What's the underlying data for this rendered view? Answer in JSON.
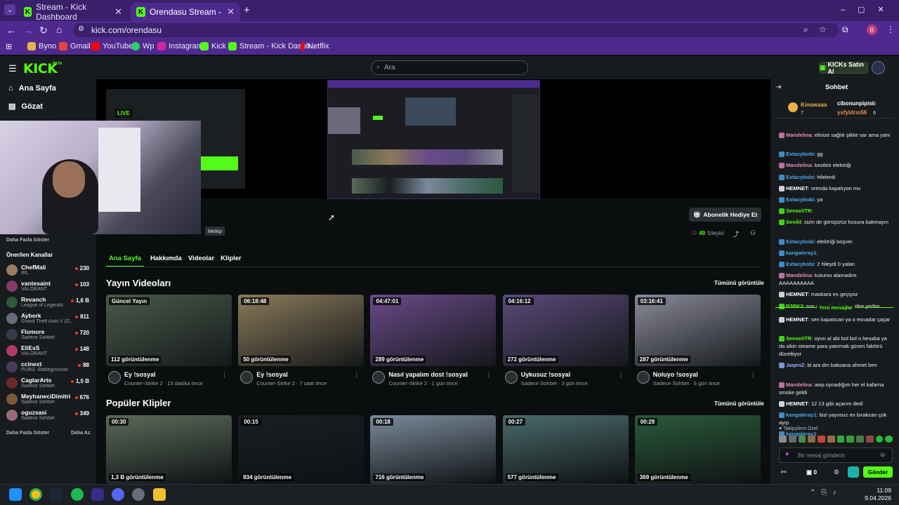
{
  "browser": {
    "tabs": [
      {
        "label": "Stream - Kick Dashboard"
      },
      {
        "label": "Orendasu Stream - Watch Live -"
      }
    ],
    "url": "kick.com/orendasu",
    "bookmarks": [
      "Byno",
      "Gmail",
      "YouTube",
      "Wp",
      "Instagram",
      "Kick",
      "Stream - Kick Dashb...",
      "Netflix"
    ],
    "profile_initial": "B"
  },
  "header": {
    "logo": "KICK",
    "logo_badge": "BETA",
    "search_placeholder": "Ara",
    "buy_label": "KICKs Satın Al"
  },
  "sidebar": {
    "nav": [
      {
        "label": "Ana Sayfa"
      },
      {
        "label": "Gözat"
      }
    ],
    "show_more": "Daha Fazla Göster",
    "recommended_title": "Önerilen Kanallar",
    "channels": [
      {
        "name": "ChefMali",
        "category": "IRL",
        "viewers": "230",
        "color": "#9a7b62"
      },
      {
        "name": "vantesaint",
        "category": "VALORANT",
        "viewers": "103",
        "color": "#8a3a6a"
      },
      {
        "name": "Revanch",
        "category": "League of Legends",
        "viewers": "1,6 B",
        "color": "#2a5a3a"
      },
      {
        "name": "Ayberk",
        "category": "Grand Theft Auto V (G...",
        "viewers": "811",
        "color": "#6a6a7a"
      },
      {
        "name": "Flomore",
        "category": "Sadece Sohbet",
        "viewers": "720",
        "color": "#3a3a4a"
      },
      {
        "name": "EliEsS",
        "category": "VALORANT",
        "viewers": "148",
        "color": "#b03a6a"
      },
      {
        "name": "ccinext",
        "category": "PUBG: Battlegrounds",
        "viewers": "88",
        "color": "#4a3a5a"
      },
      {
        "name": "CaglarArts",
        "category": "Sadece Sohbet",
        "viewers": "1,5 B",
        "color": "#6a2a2a"
      },
      {
        "name": "MeyhaneciDimitri",
        "category": "Sadece Sohbet",
        "viewers": "676",
        "color": "#7a5a3a"
      },
      {
        "name": "oguzsasi",
        "category": "Sadece Sohbet",
        "viewers": "349",
        "color": "#9a6a7a"
      }
    ],
    "show_more_bottom": "Daha Fazla Göster",
    "show_less": "Daha Az"
  },
  "player": {
    "live_label": "LIVE",
    "clip_label": "Mekip"
  },
  "stream_bar": {
    "sub_gift_label": "Abonelik Hediye Et",
    "viewers": "49",
    "viewers_label": "İzleyici"
  },
  "content_tabs": [
    "Ana Sayfa",
    "Hakkımda",
    "Videolar",
    "Klipler"
  ],
  "videos_section": {
    "title": "Yayın Videoları",
    "see_all": "Tümünü görüntüle",
    "items": [
      {
        "badge": "Güncel Yayın",
        "views": "112 görüntülenme",
        "title": "Ey !sosyal",
        "sub": "Counter-Strike 2 · 15 dakika önce",
        "bg": "#4a5a4a"
      },
      {
        "badge": "06:18:48",
        "views": "50 görüntülenme",
        "title": "Ey !sosyal",
        "sub": "Counter-Strike 2 · 7 saat önce",
        "bg": "#8a7a5a"
      },
      {
        "badge": "04:47:01",
        "views": "289 görüntülenme",
        "title": "Nasıl yapalım dost !sosyal",
        "sub": "Counter-Strike 2 · 1 gün önce",
        "bg": "#6a4a8a"
      },
      {
        "badge": "04:16:12",
        "views": "272 görüntülenme",
        "title": "Uykusuz !sosyal",
        "sub": "Sadece Sohbet · 3 gün önce",
        "bg": "#5a4a7a"
      },
      {
        "badge": "03:16:41",
        "views": "287 görüntülenme",
        "title": "Noluyo !sosyal",
        "sub": "Sadece Sohbet · 6 gün önce",
        "bg": "#8a8a9a"
      }
    ]
  },
  "clips_section": {
    "title": "Popüler Klipler",
    "see_all": "Tümünü görüntüle",
    "items": [
      {
        "badge": "00:30",
        "views": "1,3 B görüntülenme",
        "bg": "#5a6a5a"
      },
      {
        "badge": "00:15",
        "views": "834 görüntülenme",
        "bg": "#1a1e22"
      },
      {
        "badge": "00:18",
        "views": "716 görüntülenme",
        "bg": "#7a8a9a"
      },
      {
        "badge": "00:27",
        "views": "577 görüntülenme",
        "bg": "#4a6a6a"
      },
      {
        "badge": "00:29",
        "views": "369 görüntülenme",
        "bg": "#2a5a3a"
      }
    ]
  },
  "chat": {
    "title": "Sohbet",
    "top": [
      {
        "name": "Kinowaaa",
        "count": "7"
      },
      {
        "name": "cibonunpipisi",
        "count": "6"
      },
      {
        "name": "ysfyldrm56",
        "count": "6"
      }
    ],
    "messages": [
      {
        "user": "Mandelina",
        "text": "elinize sağlık şikke var ama yani",
        "color": "#e08ac0"
      },
      {
        "user": "Extacybobi",
        "text": "gg",
        "color": "#4aa8f0"
      },
      {
        "user": "Mandelina",
        "text": "kestleir elektriği",
        "color": "#e08ac0"
      },
      {
        "user": "Extacybobi",
        "text": "hilelerdi",
        "color": "#4aa8f0"
      },
      {
        "user": "HEMNET",
        "text": "orenda kapatıyon mu",
        "color": "#ffffff"
      },
      {
        "user": "Extacybobi",
        "text": "ya",
        "color": "#4aa8f0"
      },
      {
        "user": "SenseiiTR",
        "text": "",
        "color": "#53fc18"
      },
      {
        "user": "Sevilil",
        "text": "sizin de görüşürüz kusura bakmayın",
        "color": "#53fc18"
      },
      {
        "user": "Extacybobi",
        "text": "elektriği boşver",
        "color": "#4aa8f0"
      },
      {
        "user": "kangaleray1",
        "text": "",
        "color": "#4aa8f0"
      },
      {
        "user": "Extacybobi",
        "text": "2 hileydi 0 yalan",
        "color": "#4aa8f0"
      },
      {
        "user": "Mandelina",
        "text": "kutumu alamadım AAAAAAAAAA",
        "color": "#e08ac0"
      },
      {
        "user": "HEMNET",
        "text": "maskara mı geçiyoz",
        "color": "#ffffff"
      },
      {
        "user": "B3RK3",
        "text": "son round fecii bir prefire yedim",
        "color": "#53fc18"
      }
    ],
    "new_messages_label": "Yeni mesajlar",
    "messages2": [
      {
        "user": "HEMNET",
        "text": "sen kapatıcan ya o esnadar çaçar",
        "color": "#ffffff"
      },
      {
        "user": "SenseiiTR",
        "text": "oyun al abi bol bol o hesaba ya da sikin steame para yatırmak güven faktörü düzeltiyor",
        "color": "#53fc18"
      },
      {
        "user": "JaqenZ",
        "text": "bi ara dm baksana ahmet ben",
        "color": "#9ab0ff"
      },
      {
        "user": "Mandelina",
        "text": "awp oynadığım her el kafama smoke geldi",
        "color": "#e08ac0"
      },
      {
        "user": "HEMNET",
        "text": "12 13 gibi açarım dedi",
        "color": "#ffffff"
      },
      {
        "user": "kangaleray1",
        "text": "bizi yayınsız mı bırakcan çok ayıp",
        "color": "#4aa8f0"
      },
      {
        "user": "kangaleray1",
        "text": "",
        "color": "#4aa8f0"
      }
    ],
    "followers_label": "Takipçilere Özel",
    "input_placeholder": "Bir mesaj gönderin",
    "points": "0",
    "send_label": "Gönder"
  },
  "taskbar": {
    "time": "11:09",
    "date": "9.04.2026"
  }
}
